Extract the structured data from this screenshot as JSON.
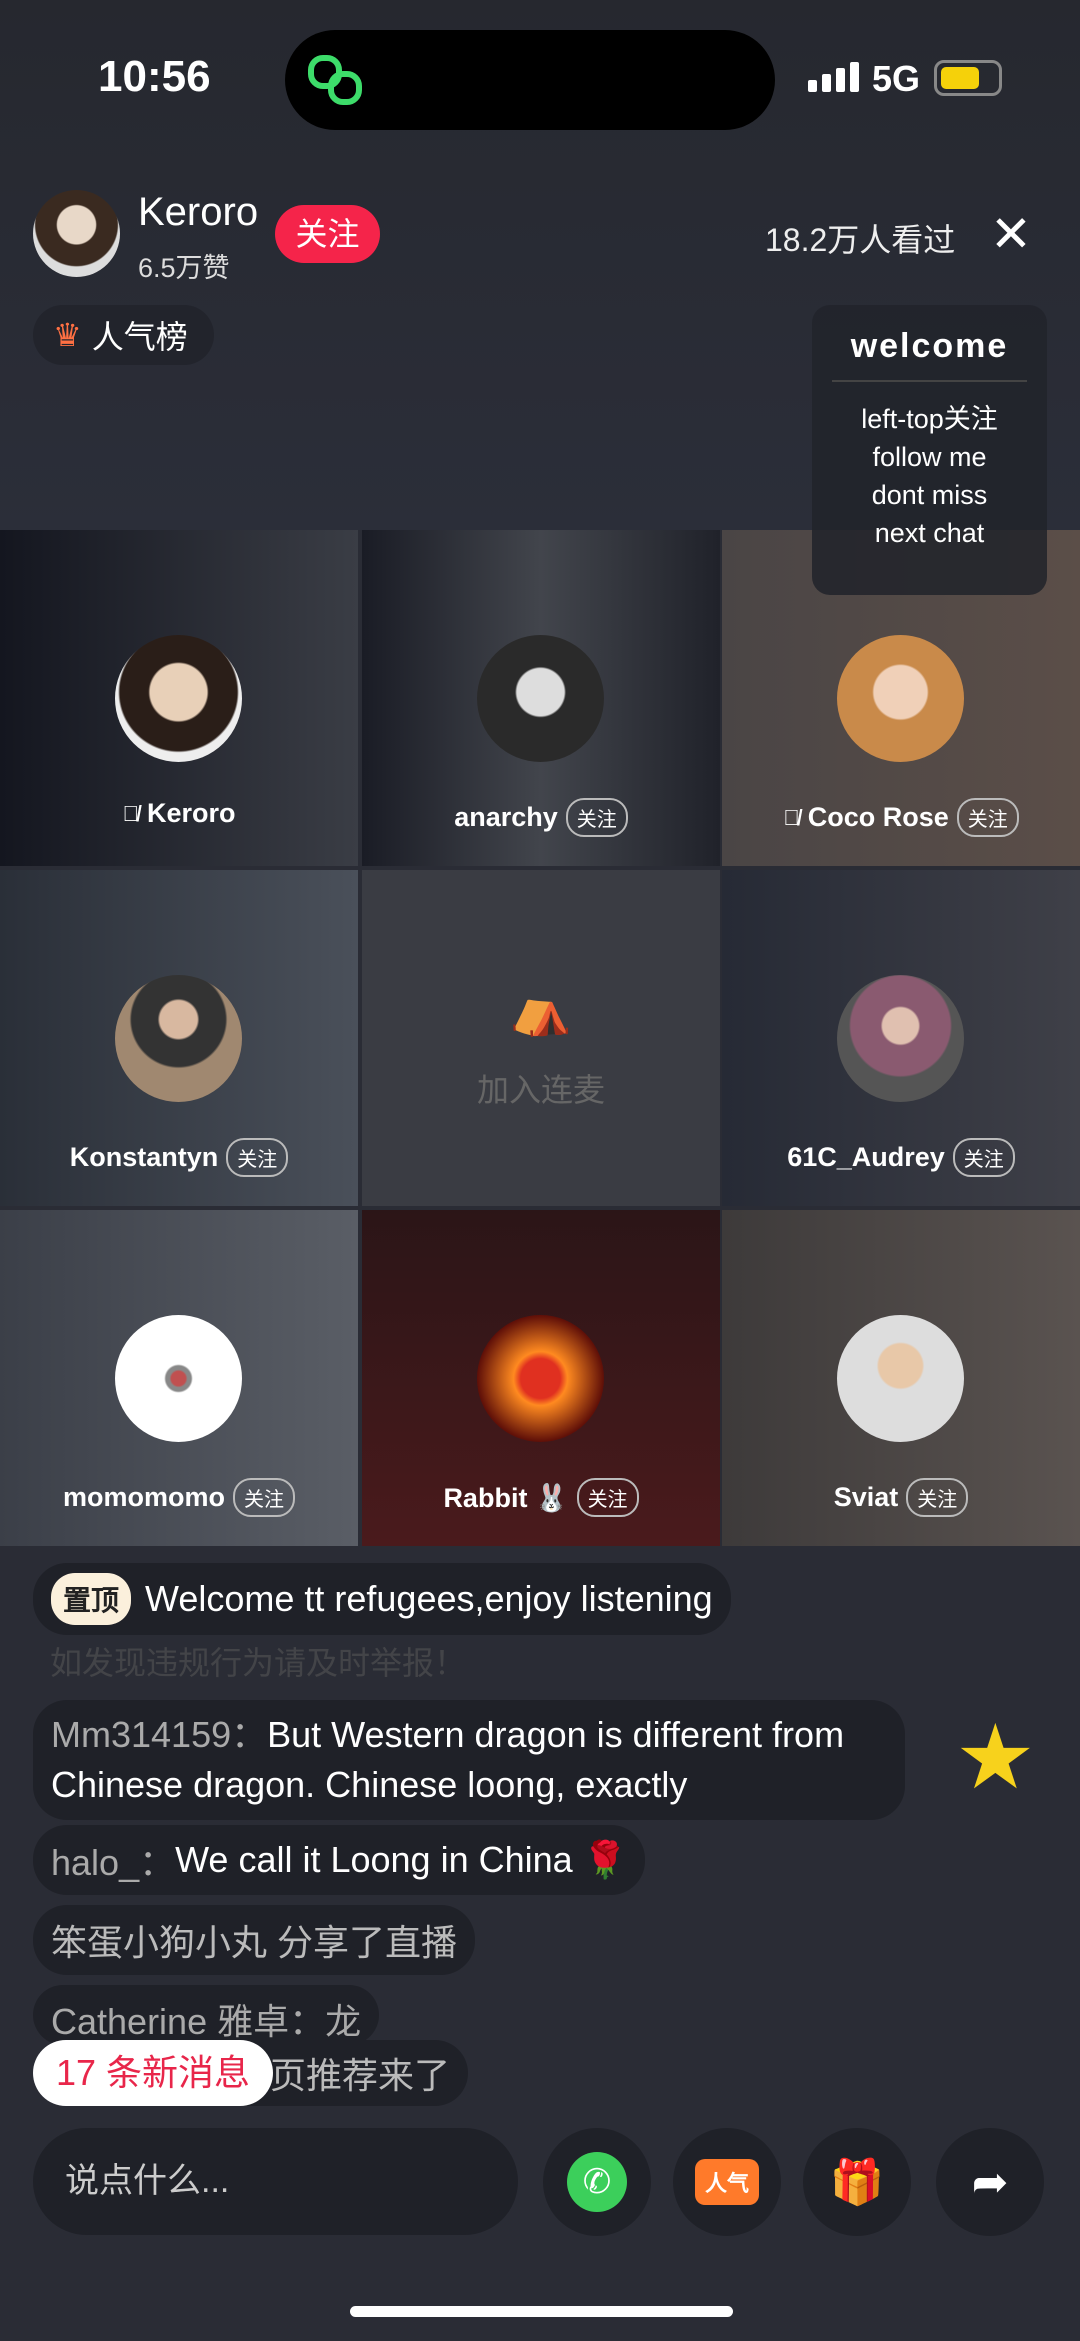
{
  "status_bar": {
    "time": "10:56",
    "network": "5G",
    "battery_level": 0.7
  },
  "host": {
    "name": "Keroro",
    "likes": "6.5万赞",
    "follow_label": "关注",
    "viewers": "18.2万人看过"
  },
  "rank_label": "人气榜",
  "welcome_card": {
    "title": "welcome",
    "lines": [
      "left-top关注",
      "follow me",
      "dont miss",
      "next chat"
    ]
  },
  "seats": [
    {
      "name": "Keroro",
      "muted": true,
      "follow": ""
    },
    {
      "name": "anarchy",
      "muted": false,
      "follow": "关注"
    },
    {
      "name": "Coco Rose",
      "muted": true,
      "follow": "关注"
    },
    {
      "name": "Konstantyn",
      "muted": false,
      "follow": "关注"
    },
    {
      "empty_label": "加入连麦"
    },
    {
      "name": "61C_Audrey",
      "muted": false,
      "follow": "关注"
    },
    {
      "name": "momomomo",
      "muted": false,
      "follow": "关注"
    },
    {
      "name": "Rabbit 🐰",
      "muted": false,
      "follow": "关注"
    },
    {
      "name": "Sviat",
      "muted": false,
      "follow": "关注"
    }
  ],
  "chat": {
    "pinned_tag": "置顶",
    "pinned_text": "Welcome tt refugees,enjoy listening",
    "faded_text": "如发现违规行为请及时举报！",
    "messages": [
      {
        "user": "Mm314159：",
        "text": "But Western dragon is different from Chinese dragon. Chinese loong, exactly"
      },
      {
        "user": "halo_：",
        "text": "We call it Loong in China 🌹"
      },
      {
        "user": "",
        "text": "笨蛋小狗小丸 分享了直播"
      },
      {
        "user": "Catherine 雅卓：",
        "text": "龙"
      },
      {
        "user": "",
        "text": "页推荐来了"
      }
    ],
    "new_messages": "17 条新消息"
  },
  "bottom": {
    "input_placeholder": "说点什么...",
    "buttons": [
      "call-icon",
      "popularity-icon",
      "gift-icon",
      "share-icon"
    ]
  },
  "colors": {
    "accent": "#f5244a",
    "background": "#2a2c35"
  }
}
